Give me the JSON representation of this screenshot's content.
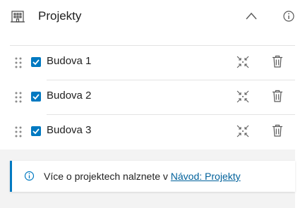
{
  "header": {
    "title": "Projekty",
    "icon": "building-icon",
    "collapse_icon": "chevron-up-icon",
    "info_icon": "info-icon"
  },
  "layers": [
    {
      "label": "Budova 1",
      "checked": true
    },
    {
      "label": "Budova 2",
      "checked": true
    },
    {
      "label": "Budova 3",
      "checked": true
    }
  ],
  "row_actions": {
    "drag_icon": "drag-handle-icon",
    "zoom_icon": "zoom-to-icon",
    "delete_icon": "trash-icon"
  },
  "notice": {
    "text": "Více o projektech nalznete v",
    "link_text": "Návod: Projekty",
    "icon": "info-icon"
  },
  "colors": {
    "accent": "#0079c1",
    "link": "#00619b",
    "footer_bg": "#f3f3f3"
  }
}
